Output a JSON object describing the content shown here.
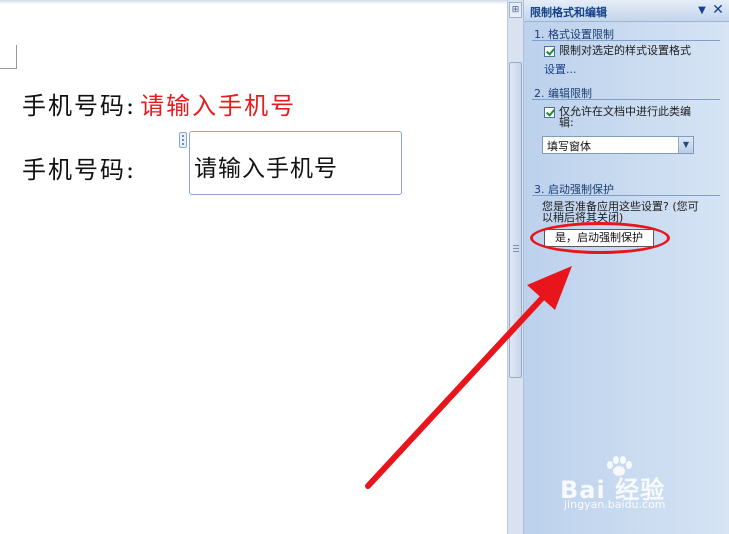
{
  "document": {
    "line1_label": "手机号码:",
    "line1_value": "请输入手机号",
    "line2_label": "手机号码:",
    "line2_value": "请输入手机号"
  },
  "scrollbar": {
    "top_button_icon": "browse-object-icon"
  },
  "task_pane": {
    "title": "限制格式和编辑",
    "dropdown_icon": "▼",
    "close_icon": "✕",
    "section1": {
      "heading": "1. 格式设置限制",
      "checkbox_label_line1": "限制对选定的样式设置格式",
      "checkbox_label_line2": "设置..."
    },
    "section2": {
      "heading": "2. 编辑限制",
      "checkbox_label_line1": "仅允许在文档中进行此类编",
      "checkbox_label_line2": "辑:",
      "select_value": "填写窗体"
    },
    "section3": {
      "heading": "3. 启动强制保护",
      "description_line1": "您是否准备应用这些设置? (您可",
      "description_line2": "以稍后将其关闭)",
      "button_label": "是，启动强制保护"
    }
  },
  "annotation": {
    "color": "#e8161c"
  },
  "watermark": {
    "brand": "Bai 经验",
    "url": "jingyan.baidu.com"
  }
}
